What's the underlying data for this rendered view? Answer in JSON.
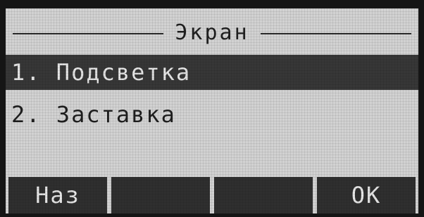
{
  "screen": {
    "title": "Экран"
  },
  "menu": {
    "items": [
      {
        "label": "1. Подсветка",
        "selected": true
      },
      {
        "label": "2. Заставка",
        "selected": false
      }
    ]
  },
  "softkeys": [
    {
      "label": "Наз"
    },
    {
      "label": ""
    },
    {
      "label": ""
    },
    {
      "label": "OK"
    }
  ],
  "colors": {
    "lcd_background": "#d2d2d2",
    "highlight": "#373737",
    "text_dark": "#1f1f1f",
    "text_light": "#e6e6e6"
  }
}
